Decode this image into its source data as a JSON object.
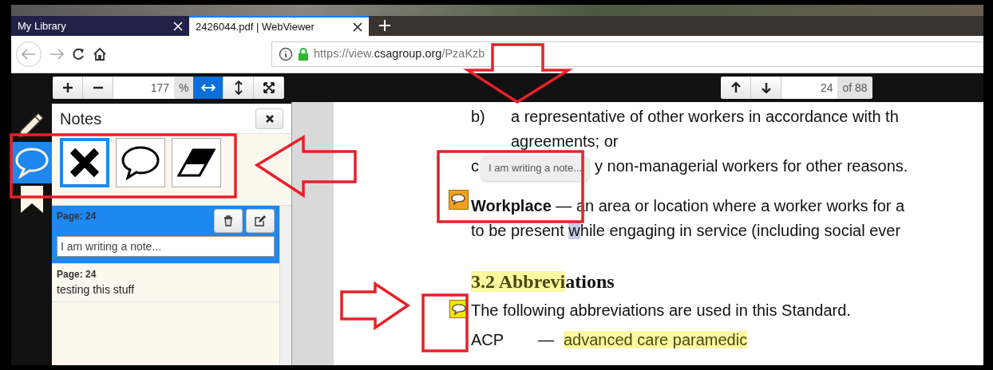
{
  "browser": {
    "tabs": [
      {
        "title": "My Library",
        "selected": false
      },
      {
        "title": "2426044.pdf | WebViewer",
        "selected": true
      }
    ],
    "url": [
      {
        "text": "https://view."
      },
      {
        "text": "csagroup.org",
        "strong": true
      },
      {
        "text": "/PzaKzb"
      }
    ]
  },
  "toolbar": {
    "zoom": "177",
    "zoom_unit": "%",
    "fit_buttons": [
      {
        "kind": "fit-width",
        "selected": true
      },
      {
        "kind": "fit-height",
        "selected": false
      },
      {
        "kind": "fullscreen",
        "selected": false
      }
    ],
    "page": "24",
    "page_total": "of 88"
  },
  "sidebar": {
    "items": [
      {
        "kind": "pencil",
        "selected": false
      },
      {
        "kind": "comment",
        "selected": true
      },
      {
        "kind": "bookmark",
        "selected": false
      }
    ]
  },
  "notes_panel": {
    "title": "Notes",
    "tools": [
      {
        "kind": "cross",
        "selected": true
      },
      {
        "kind": "comment",
        "selected": false
      },
      {
        "kind": "eraser",
        "selected": false
      }
    ],
    "notes": [
      {
        "page": "Page: 24",
        "text": "I am writing a note...",
        "selected": true
      },
      {
        "page": "Page: 24",
        "text": "testing this stuff",
        "selected": false
      }
    ]
  },
  "document": {
    "blocks": [
      {
        "kind": "item",
        "label": "b)",
        "lines": [
          [
            {
              "text": "a representative of other workers in accordance with th"
            }
          ],
          [
            {
              "text": "agreements; or"
            }
          ]
        ]
      },
      {
        "kind": "item",
        "label": "c",
        "tooltip": "I am writing a note...",
        "lines": [
          [
            {
              "text": "y non-managerial workers for other reasons."
            }
          ]
        ]
      },
      {
        "kind": "paragraph",
        "marker": {
          "color": "#f0a020"
        },
        "lines": [
          [
            {
              "text": "**Workplace** — an area or location where a worker works for a"
            }
          ],
          [
            {
              "text": "to be present "
            },
            {
              "text": "w",
              "color": "#c4cce8"
            },
            {
              "text": "hile engaging in service (including social ever"
            }
          ]
        ]
      },
      {
        "kind": "heading",
        "lines": [
          [
            {
              "text": "3.2 Abbrevi",
              "color": "#fbf8a0"
            },
            {
              "text": "ations"
            }
          ]
        ]
      },
      {
        "kind": "paragraph",
        "marker": {
          "color": "#f5e400"
        },
        "lines": [
          [
            {
              "text": "The following abbreviations are used in this Standard."
            }
          ]
        ]
      },
      {
        "kind": "term",
        "label": "ACP",
        "dash": "—",
        "lines": [
          [
            {
              "text": "advanced care paramedic",
              "color": "#fbf8a0"
            }
          ]
        ]
      }
    ]
  }
}
